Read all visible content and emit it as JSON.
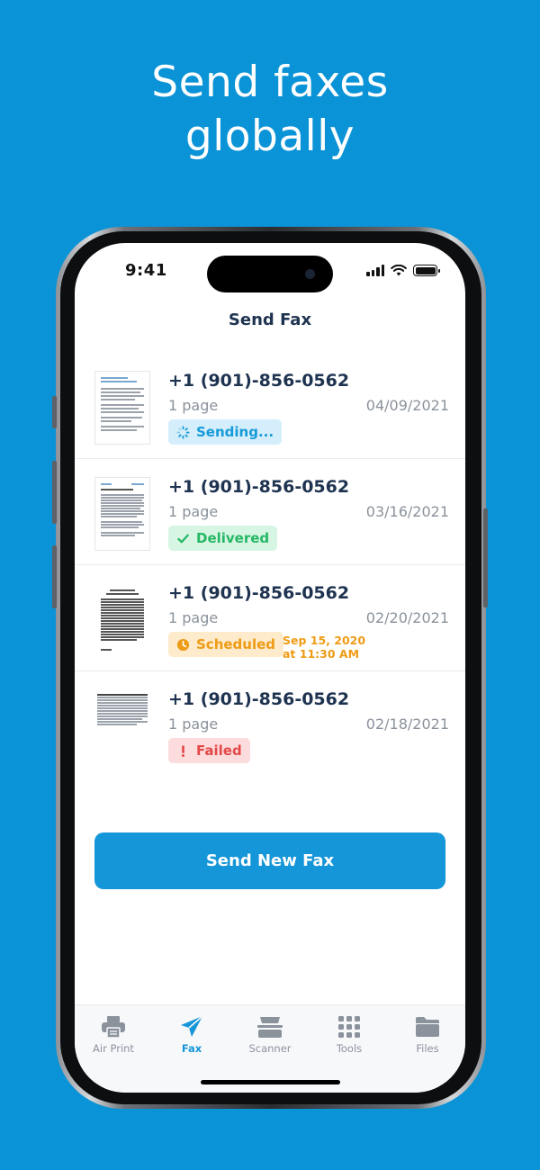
{
  "headline": {
    "line1": "Send faxes",
    "line2": "globally"
  },
  "status_bar": {
    "time": "9:41"
  },
  "nav": {
    "title": "Send Fax"
  },
  "faxes": [
    {
      "number": "+1 (901)-856-0562",
      "pages": "1 page",
      "date": "04/09/2021",
      "status": "Sending..."
    },
    {
      "number": "+1 (901)-856-0562",
      "pages": "1 page",
      "date": "03/16/2021",
      "status": "Delivered"
    },
    {
      "number": "+1 (901)-856-0562",
      "pages": "1 page",
      "date": "02/20/2021",
      "status": "Scheduled",
      "scheduled_date": "Sep 15, 2020",
      "scheduled_time": "at 11:30 AM"
    },
    {
      "number": "+1 (901)-856-0562",
      "pages": "1 page",
      "date": "02/18/2021",
      "status": "Failed"
    }
  ],
  "actions": {
    "send_new": "Send New Fax"
  },
  "tabs": [
    {
      "label": "Air Print",
      "icon": "printer-icon"
    },
    {
      "label": "Fax",
      "icon": "paper-plane-icon",
      "active": true
    },
    {
      "label": "Scanner",
      "icon": "scanner-icon"
    },
    {
      "label": "Tools",
      "icon": "grid-icon"
    },
    {
      "label": "Files",
      "icon": "folder-icon"
    }
  ],
  "colors": {
    "background": "#0a93d6",
    "accent": "#1596d8",
    "sending": "#169bd9",
    "delivered": "#25b865",
    "scheduled": "#ee9b15",
    "failed": "#e44848",
    "title_text": "#1e3350"
  }
}
